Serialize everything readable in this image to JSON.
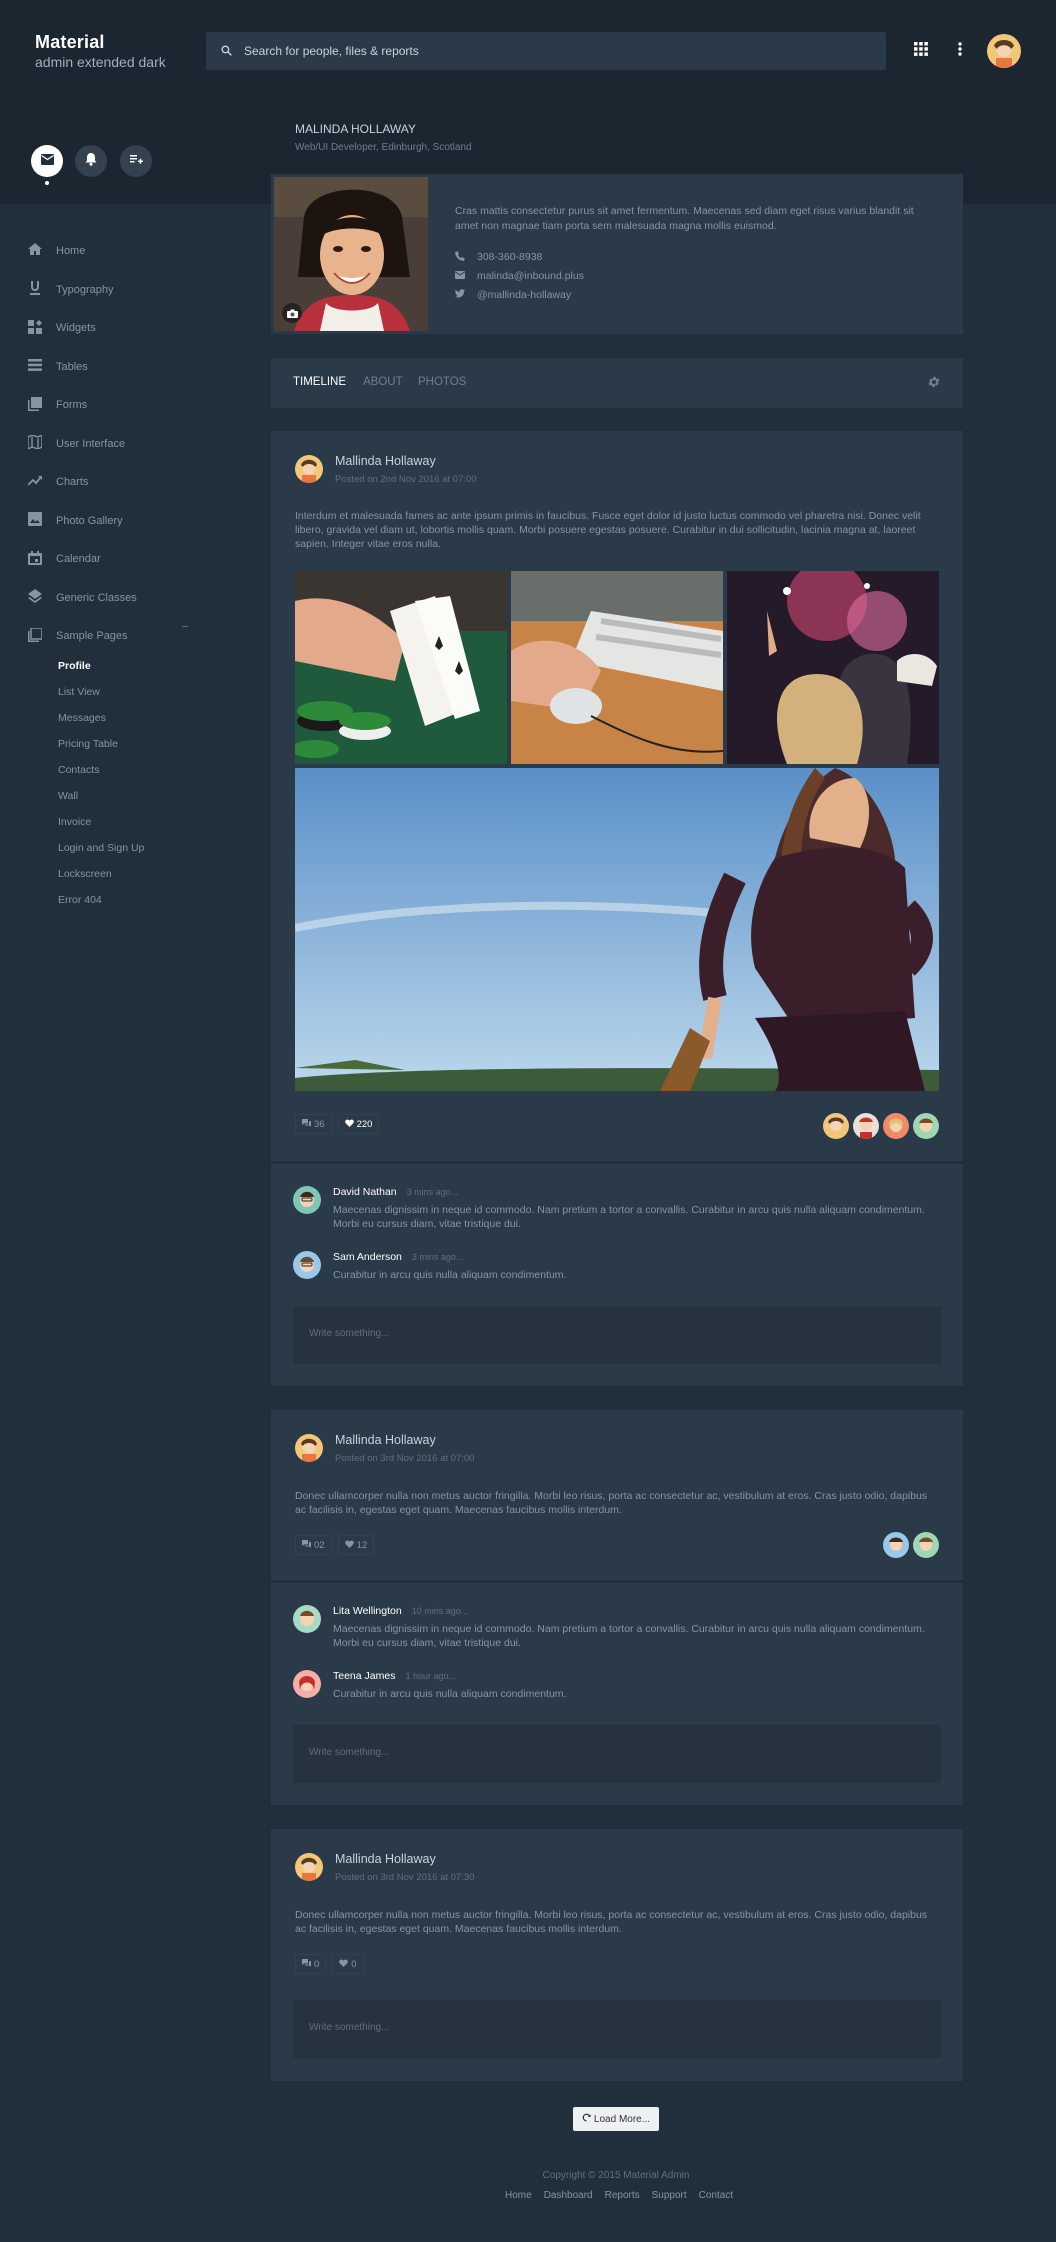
{
  "brand": {
    "title": "Material",
    "subtitle": "admin extended dark"
  },
  "search": {
    "placeholder": "Search for people, files & reports"
  },
  "header": {
    "icons": [
      "apps-icon",
      "more-vert-icon",
      "user-avatar"
    ]
  },
  "sidebar": {
    "quick_actions": [
      "email-icon",
      "bell-icon",
      "playlist-add-icon"
    ],
    "items": [
      {
        "label": "Home",
        "icon": "home-icon"
      },
      {
        "label": "Typography",
        "icon": "underline-icon"
      },
      {
        "label": "Widgets",
        "icon": "widgets-icon"
      },
      {
        "label": "Tables",
        "icon": "list-icon"
      },
      {
        "label": "Forms",
        "icon": "forms-icon"
      },
      {
        "label": "User Interface",
        "icon": "map-icon"
      },
      {
        "label": "Charts",
        "icon": "trending-icon"
      },
      {
        "label": "Photo Gallery",
        "icon": "image-icon"
      },
      {
        "label": "Calendar",
        "icon": "calendar-icon"
      },
      {
        "label": "Generic Classes",
        "icon": "layers-icon"
      },
      {
        "label": "Sample Pages",
        "icon": "pages-icon"
      }
    ],
    "sub_items": [
      "Profile",
      "List View",
      "Messages",
      "Pricing Table",
      "Contacts",
      "Wall",
      "Invoice",
      "Login and Sign Up",
      "Lockscreen",
      "Error 404"
    ],
    "active_sub": "Profile"
  },
  "profile": {
    "name": "MALINDA HOLLAWAY",
    "subtitle": "Web/UI Developer, Edinburgh, Scotland",
    "bio": "Cras mattis consectetur purus sit amet fermentum. Maecenas sed diam eget risus varius blandit sit amet non magnae tiam porta sem malesuada magna mollis euismod.",
    "phone": "308-360-8938",
    "email": "malinda@inbound.plus",
    "twitter": "@mallinda-hollaway"
  },
  "tabs": {
    "timeline": "TIMELINE",
    "about": "ABOUT",
    "photos": "PHOTOS",
    "active": "TIMELINE"
  },
  "posts": [
    {
      "author": "Mallinda Hollaway",
      "date": "Posted on 2nd Nov 2016 at 07:00",
      "text": "Interdum et malesuada fames ac ante ipsum primis in faucibus. Fusce eget dolor id justo luctus commodo vel pharetra nisi. Donec velit libero, gravida vel diam ut, lobortis mollis quam. Morbi posuere egestas posuere. Curabitur in dui sollicitudin, lacinia magna at, laoreet sapien. Integer vitae eros nulla.",
      "comments_count": "36",
      "likes_count": "220",
      "comments": [
        {
          "name": "David Nathan",
          "time": "3 mins ago...",
          "text": "Maecenas dignissim in neque id commodo. Nam pretium a tortor a convallis. Curabitur in arcu quis nulla aliquam condimentum. Morbi eu cursus diam, vitae tristique dui."
        },
        {
          "name": "Sam Anderson",
          "time": "3 mins ago...",
          "text": "Curabitur in arcu quis nulla aliquam condimentum."
        }
      ],
      "write_placeholder": "Write something..."
    },
    {
      "author": "Mallinda Hollaway",
      "date": "Posted on 3rd Nov 2016 at 07:00",
      "text": "Donec ullamcorper nulla non metus auctor fringilla. Morbi leo risus, porta ac consectetur ac, vestibulum at eros. Cras justo odio, dapibus ac facilisis in, egestas eget quam. Maecenas faucibus mollis interdum.",
      "comments_count": "02",
      "likes_count": "12",
      "comments": [
        {
          "name": "Lita Wellington",
          "time": "10 mins ago...",
          "text": "Maecenas dignissim in neque id commodo. Nam pretium a tortor a convallis. Curabitur in arcu quis nulla aliquam condimentum. Morbi eu cursus diam, vitae tristique dui."
        },
        {
          "name": "Teena James",
          "time": "1 hour ago...",
          "text": "Curabitur in arcu quis nulla aliquam condimentum."
        }
      ],
      "write_placeholder": "Write something..."
    },
    {
      "author": "Mallinda Hollaway",
      "date": "Posted on 3rd Nov 2016 at 07:30",
      "text": "Donec ullamcorper nulla non metus auctor fringilla. Morbi leo risus, porta ac consectetur ac, vestibulum at eros. Cras justo odio, dapibus ac facilisis in, egestas eget quam. Maecenas faucibus mollis interdum.",
      "comments_count": "0",
      "likes_count": "0",
      "write_placeholder": "Write something..."
    }
  ],
  "load_more": "Load More...",
  "footer": {
    "copyright": "Copyright © 2015 Material Admin",
    "links": [
      "Home",
      "Dashboard",
      "Reports",
      "Support",
      "Contact"
    ]
  },
  "colors": {
    "background": "#212f3c",
    "card": "#2b3a48",
    "accent": "#ffffff"
  }
}
